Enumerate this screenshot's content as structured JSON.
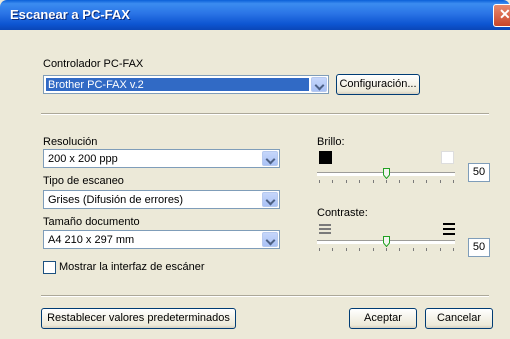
{
  "window": {
    "title": "Escanear a PC-FAX",
    "close_glyph": "✕"
  },
  "driver": {
    "label": "Controlador PC-FAX",
    "selected": "Brother PC-FAX v.2",
    "config_button": "Configuración..."
  },
  "resolution": {
    "label": "Resolución",
    "selected": "200 x 200 ppp"
  },
  "scan_type": {
    "label": "Tipo de escaneo",
    "selected": "Grises (Difusión de errores)"
  },
  "doc_size": {
    "label": "Tamaño documento",
    "selected": "A4 210 x 297 mm"
  },
  "show_interface": {
    "label": "Mostrar la interfaz de escáner",
    "checked": false
  },
  "brightness": {
    "label": "Brillo:",
    "value": "50",
    "level": 0.5,
    "min_icon": "dark-square-icon",
    "max_icon": "light-square-icon"
  },
  "contrast": {
    "label": "Contraste:",
    "value": "50",
    "level": 0.5,
    "min_icon": "low-contrast-icon",
    "max_icon": "high-contrast-icon"
  },
  "footer": {
    "reset_button": "Restablecer valores predeterminados",
    "ok_button": "Aceptar",
    "cancel_button": "Cancelar"
  },
  "colors": {
    "titlebar": "#0a5fd8",
    "selection": "#316ac5",
    "dialog_bg": "#ece9d8",
    "close": "#c9452a"
  }
}
